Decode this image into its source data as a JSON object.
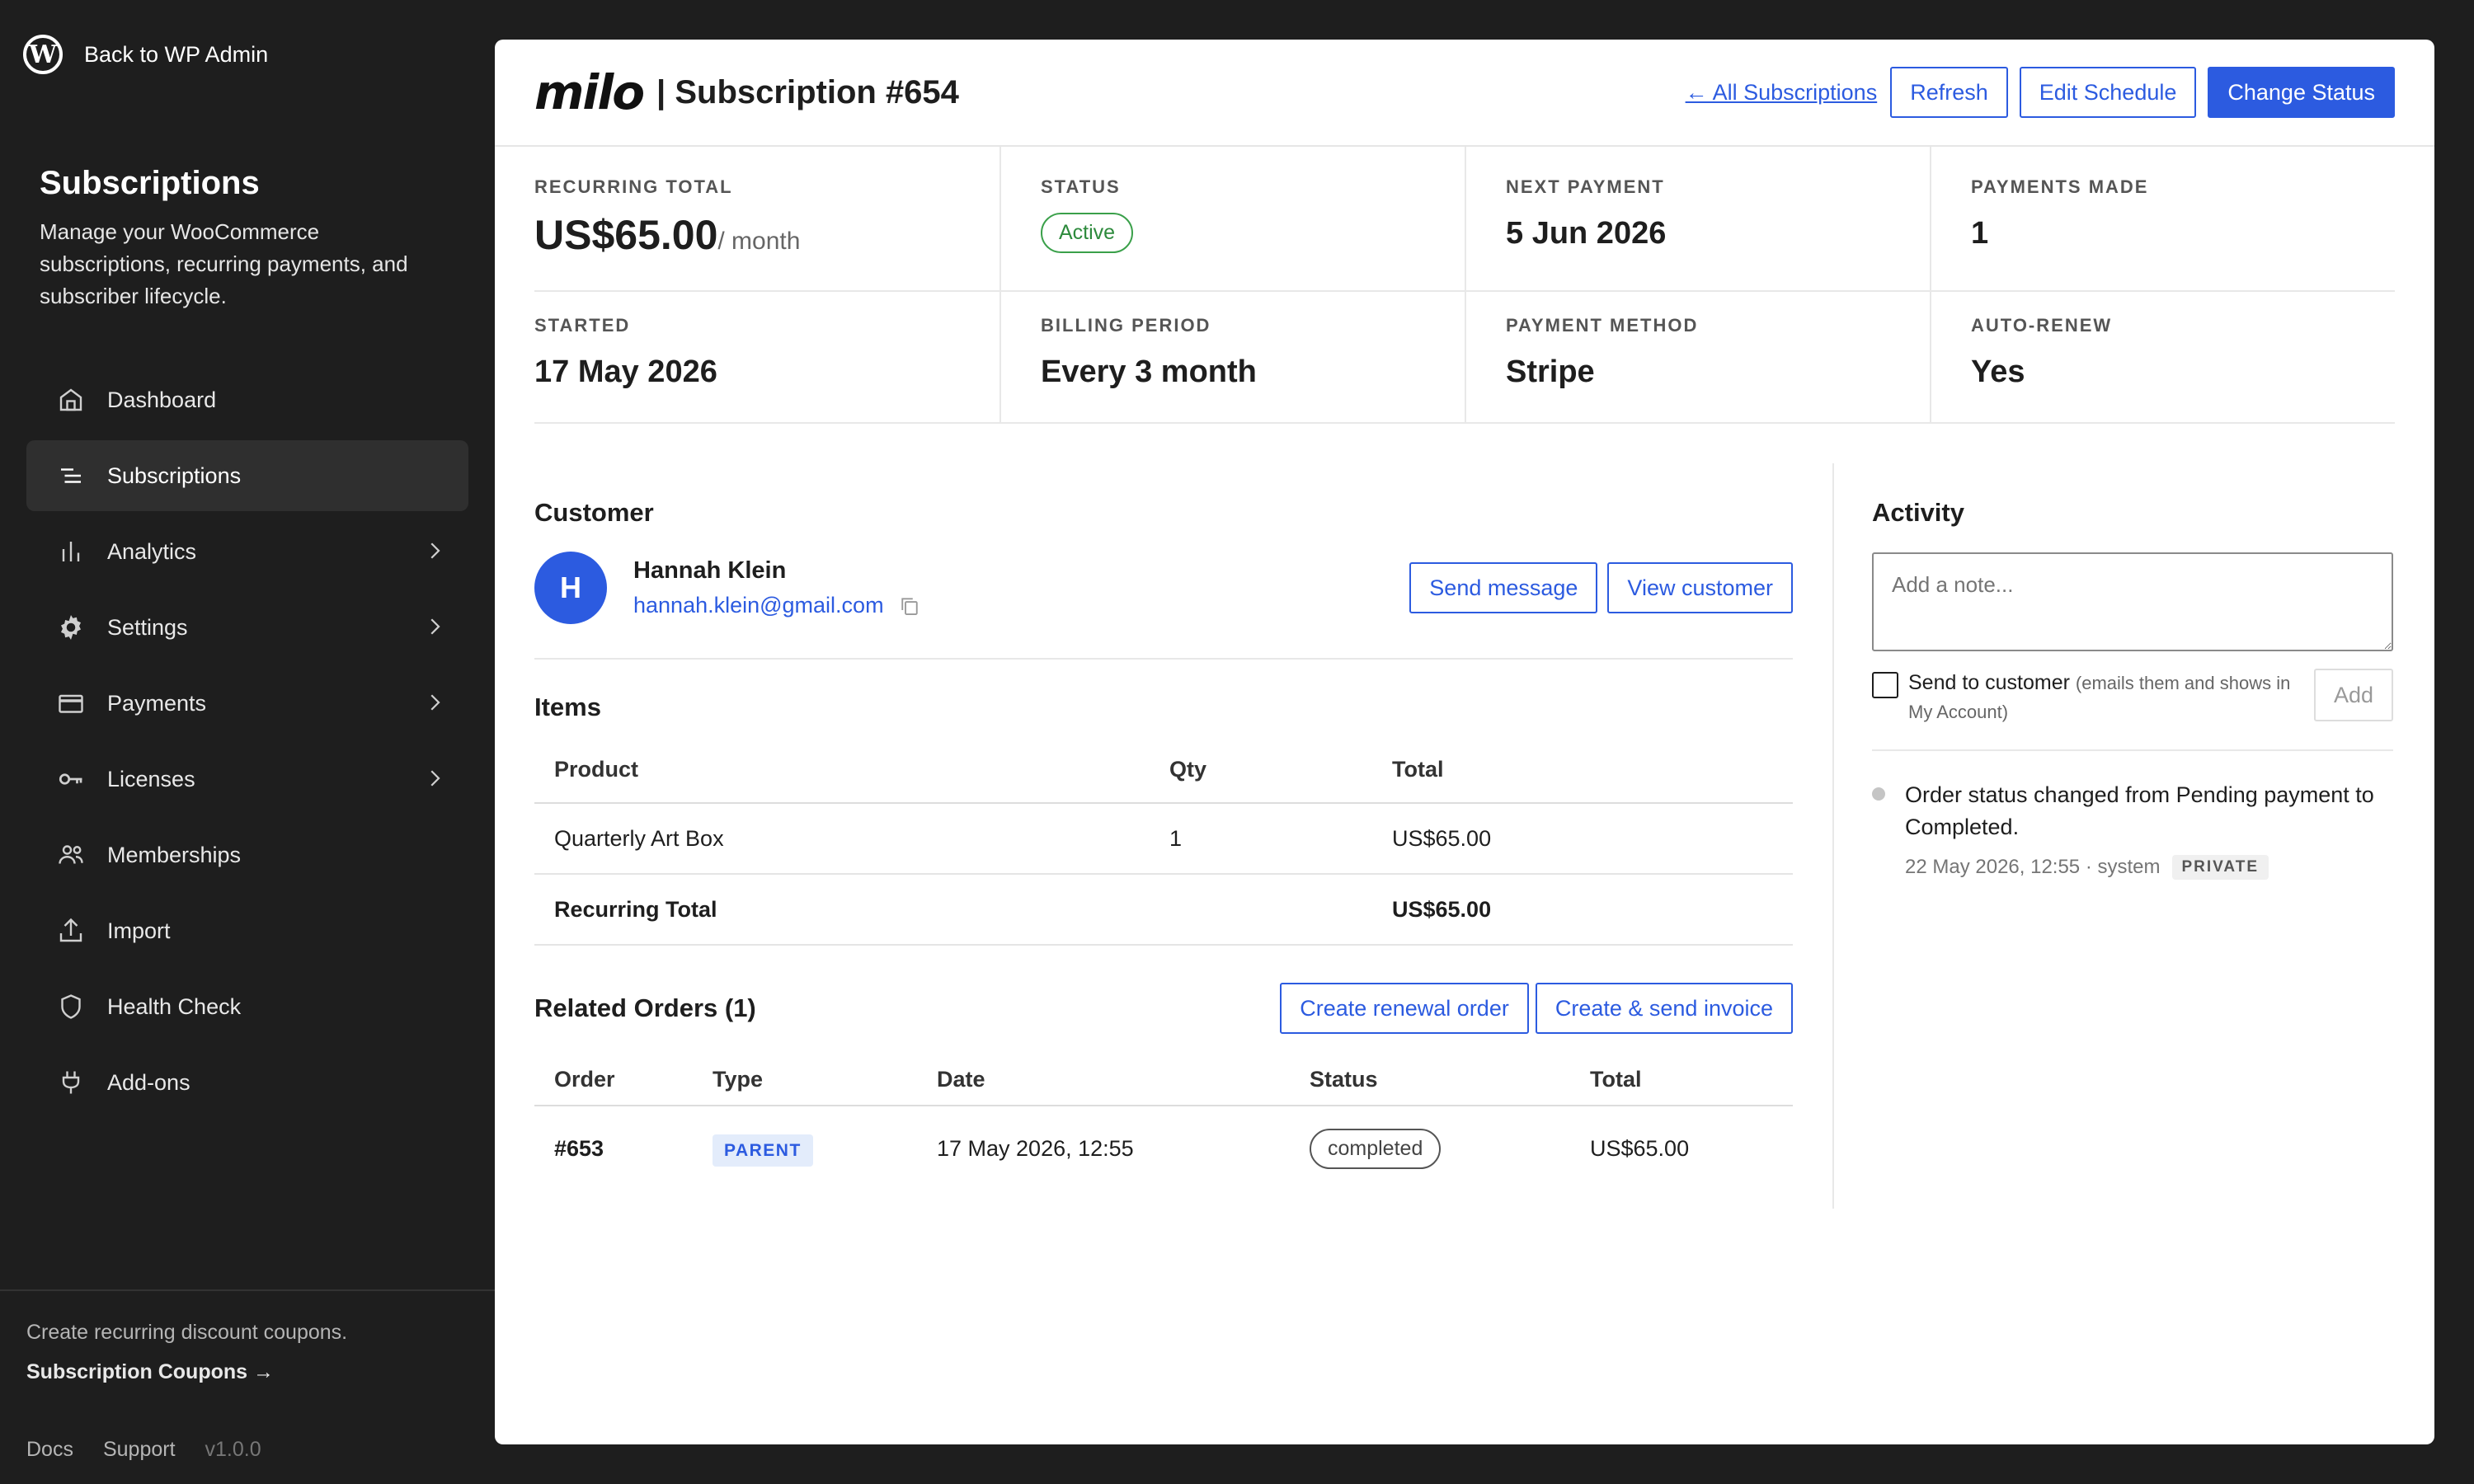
{
  "sidebar": {
    "back_label": "Back to WP Admin",
    "heading": "Subscriptions",
    "description": "Manage your WooCommerce subscriptions, recurring payments, and subscriber lifecycle.",
    "nav": [
      {
        "label": "Dashboard",
        "icon": "home-icon"
      },
      {
        "label": "Subscriptions",
        "icon": "list-icon",
        "active": true
      },
      {
        "label": "Analytics",
        "icon": "bar-chart-icon",
        "chevron": true
      },
      {
        "label": "Settings",
        "icon": "gear-icon",
        "chevron": true
      },
      {
        "label": "Payments",
        "icon": "credit-card-icon",
        "chevron": true
      },
      {
        "label": "Licenses",
        "icon": "key-icon",
        "chevron": true
      },
      {
        "label": "Memberships",
        "icon": "users-icon"
      },
      {
        "label": "Import",
        "icon": "upload-icon"
      },
      {
        "label": "Health Check",
        "icon": "shield-icon"
      },
      {
        "label": "Add-ons",
        "icon": "plug-icon"
      }
    ],
    "promo_text": "Create recurring discount coupons.",
    "promo_link": "Subscription Coupons →",
    "footer": {
      "docs": "Docs",
      "support": "Support",
      "version": "v1.0.0"
    }
  },
  "header": {
    "brand": "milo",
    "title": "| Subscription #654",
    "all_link": "← All Subscriptions",
    "refresh": "Refresh",
    "edit_schedule": "Edit Schedule",
    "change_status": "Change Status"
  },
  "stats": {
    "recurring_total": {
      "label": "RECURRING TOTAL",
      "value": "US$65.00",
      "suffix": "/ month"
    },
    "status": {
      "label": "STATUS",
      "value": "Active"
    },
    "next_payment": {
      "label": "NEXT PAYMENT",
      "value": "5 Jun 2026"
    },
    "payments_made": {
      "label": "PAYMENTS MADE",
      "value": "1"
    },
    "started": {
      "label": "STARTED",
      "value": "17 May 2026"
    },
    "billing_period": {
      "label": "BILLING PERIOD",
      "value": "Every 3 month"
    },
    "payment_method": {
      "label": "PAYMENT METHOD",
      "value": "Stripe"
    },
    "auto_renew": {
      "label": "AUTO-RENEW",
      "value": "Yes"
    }
  },
  "customer": {
    "section_title": "Customer",
    "initial": "H",
    "name": "Hannah Klein",
    "email": "hannah.klein@gmail.com",
    "send_message": "Send message",
    "view_customer": "View customer"
  },
  "items": {
    "section_title": "Items",
    "columns": [
      "Product",
      "Qty",
      "Total"
    ],
    "rows": [
      {
        "product": "Quarterly Art Box",
        "qty": "1",
        "total": "US$65.00"
      }
    ],
    "total_label": "Recurring Total",
    "total_value": "US$65.00"
  },
  "related": {
    "section_title": "Related Orders (1)",
    "create_renewal": "Create renewal order",
    "create_invoice": "Create & send invoice",
    "columns": [
      "Order",
      "Type",
      "Date",
      "Status",
      "Total"
    ],
    "rows": [
      {
        "order": "#653",
        "type": "PARENT",
        "date": "17 May 2026, 12:55",
        "status": "completed",
        "total": "US$65.00"
      }
    ]
  },
  "activity": {
    "section_title": "Activity",
    "note_placeholder": "Add a note...",
    "send_to_customer": "Send to customer",
    "send_hint": "(emails them and shows in My Account)",
    "add_label": "Add",
    "entries": [
      {
        "text": "Order status changed from Pending payment to Completed.",
        "meta": "22 May 2026, 12:55 · system",
        "badge": "PRIVATE"
      }
    ]
  },
  "colors": {
    "accent": "#2c5be0",
    "sidebar_bg": "#1e1e1e",
    "active_green": "#3aa04a"
  }
}
